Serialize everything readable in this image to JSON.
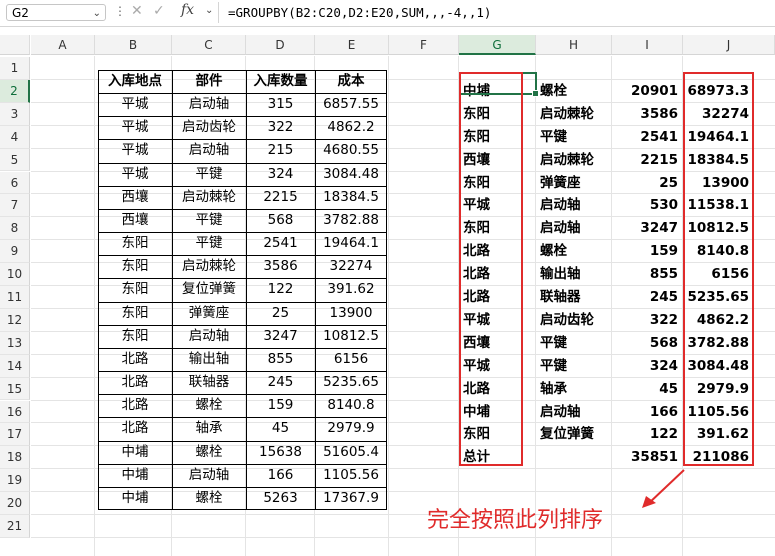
{
  "formula_bar": {
    "name_box": "G2",
    "formula": "=GROUPBY(B2:C20,D2:E20,SUM,,,-4,,1)",
    "icons": [
      "chevron-down-icon",
      "more-icon",
      "cancel-icon",
      "confirm-icon",
      "function-icon"
    ]
  },
  "columns": [
    "A",
    "B",
    "C",
    "D",
    "E",
    "F",
    "G",
    "H",
    "I",
    "J"
  ],
  "rows": [
    "1",
    "2",
    "3",
    "4",
    "5",
    "6",
    "7",
    "8",
    "9",
    "10",
    "11",
    "12",
    "13",
    "14",
    "15",
    "16",
    "17",
    "18",
    "19",
    "20",
    "21"
  ],
  "source_table": {
    "headers": [
      "入库地点",
      "部件",
      "入库数量",
      "成本"
    ],
    "rows": [
      [
        "平城",
        "启动轴",
        "315",
        "6857.55"
      ],
      [
        "平城",
        "启动齿轮",
        "322",
        "4862.2"
      ],
      [
        "平城",
        "启动轴",
        "215",
        "4680.55"
      ],
      [
        "平城",
        "平键",
        "324",
        "3084.48"
      ],
      [
        "西壤",
        "启动棘轮",
        "2215",
        "18384.5"
      ],
      [
        "西壤",
        "平键",
        "568",
        "3782.88"
      ],
      [
        "东阳",
        "平键",
        "2541",
        "19464.1"
      ],
      [
        "东阳",
        "启动棘轮",
        "3586",
        "32274"
      ],
      [
        "东阳",
        "复位弹簧",
        "122",
        "391.62"
      ],
      [
        "东阳",
        "弹簧座",
        "25",
        "13900"
      ],
      [
        "东阳",
        "启动轴",
        "3247",
        "10812.5"
      ],
      [
        "北路",
        "输出轴",
        "855",
        "6156"
      ],
      [
        "北路",
        "联轴器",
        "245",
        "5235.65"
      ],
      [
        "北路",
        "螺栓",
        "159",
        "8140.8"
      ],
      [
        "北路",
        "轴承",
        "45",
        "2979.9"
      ],
      [
        "中埔",
        "螺栓",
        "15638",
        "51605.4"
      ],
      [
        "中埔",
        "启动轴",
        "166",
        "1105.56"
      ],
      [
        "中埔",
        "螺栓",
        "5263",
        "17367.9"
      ]
    ]
  },
  "result": {
    "rows": [
      [
        "中埔",
        "螺栓",
        "20901",
        "68973.3"
      ],
      [
        "东阳",
        "启动棘轮",
        "3586",
        "32274"
      ],
      [
        "东阳",
        "平键",
        "2541",
        "19464.1"
      ],
      [
        "西壤",
        "启动棘轮",
        "2215",
        "18384.5"
      ],
      [
        "东阳",
        "弹簧座",
        "25",
        "13900"
      ],
      [
        "平城",
        "启动轴",
        "530",
        "11538.1"
      ],
      [
        "东阳",
        "启动轴",
        "3247",
        "10812.5"
      ],
      [
        "北路",
        "螺栓",
        "159",
        "8140.8"
      ],
      [
        "北路",
        "输出轴",
        "855",
        "6156"
      ],
      [
        "北路",
        "联轴器",
        "245",
        "5235.65"
      ],
      [
        "平城",
        "启动齿轮",
        "322",
        "4862.2"
      ],
      [
        "西壤",
        "平键",
        "568",
        "3782.88"
      ],
      [
        "平城",
        "平键",
        "324",
        "3084.48"
      ],
      [
        "北路",
        "轴承",
        "45",
        "2979.9"
      ],
      [
        "中埔",
        "启动轴",
        "166",
        "1105.56"
      ],
      [
        "东阳",
        "复位弹簧",
        "122",
        "391.62"
      ]
    ],
    "total_label": "总计",
    "total_qty": "35851",
    "total_cost": "211086"
  },
  "annotation": {
    "text": "完全按照此列排序",
    "color": "#e02b2b"
  },
  "colors": {
    "accent": "#217346",
    "highlight": "#e02b2b"
  }
}
